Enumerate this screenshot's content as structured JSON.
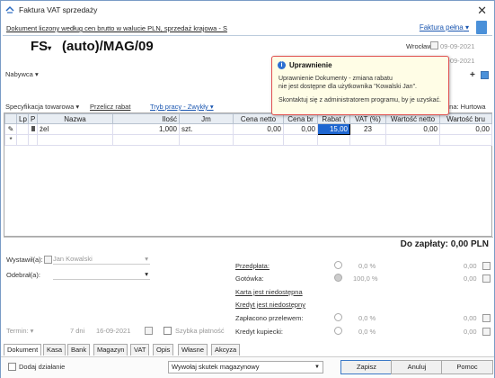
{
  "window": {
    "title": "Faktura VAT sprzedaży",
    "close": "✕"
  },
  "info": {
    "doc_desc": "Dokument liczony według cen brutto w walucie PLN, sprzedaż krajowa - S",
    "faktura": "Faktura pełna"
  },
  "header": {
    "series": "FS",
    "number": "(auto)/MAG/09",
    "location": "Wrocław",
    "date1": "09-09-2021",
    "date2": "09-09-2021",
    "nabywca_label": "Nabywca"
  },
  "toolbar": {
    "spec": "Specyfikacja towarowa",
    "przelicz": "Przelicz rabat",
    "tryb": "Tryb pracy - Zwykły",
    "cena": "ena: Hurtowa"
  },
  "columns": [
    "Lp",
    "P",
    "Nazwa",
    "Ilość",
    "Jm",
    "Cena netto",
    "Cena br",
    "Rabat (",
    "VAT (%)",
    "Wartość netto",
    "Wartość bru"
  ],
  "rows": [
    {
      "lp": "",
      "p": "",
      "nazwa": "żel",
      "ilosc": "1,000",
      "jm": "szt.",
      "cena_netto": "0,00",
      "cena_br": "0,00",
      "rabat": "15,00",
      "vat": "23",
      "wart_netto": "0,00",
      "wart_brutto": "0,00"
    }
  ],
  "popup": {
    "title": "Uprawnienie",
    "line1": "Uprawnienie Dokumenty - zmiana rabatu",
    "line2": "nie jest dostępne dla użytkownika \"Kowalski Jan\".",
    "line3": "Skontaktuj się z administratorem programu, by je uzyskać."
  },
  "total": "Do zapłaty: 0,00 PLN",
  "left": {
    "wystawil_label": "Wystawił(a):",
    "wystawil_value": "Jan Kowalski",
    "odebral_label": "Odebrał(a):",
    "termin_label": "Termin:",
    "termin_days": "7 dni",
    "termin_date": "16-09-2021",
    "szybka": "Szybka płatność"
  },
  "right": {
    "przedplata": "Przedpłata:",
    "gotowka": "Gotówka:",
    "karta": "Karta jest niedostępna",
    "kredyt": "Kredyt jest niedostępny",
    "zaplacono": "Zapłacono przelewem:",
    "kredyt_kup": "Kredyt kupiecki:",
    "pct0": "0,0 %",
    "pct100": "100,0 %",
    "zero": "0,00"
  },
  "tabs": [
    "Dokument",
    "Kasa",
    "Bank",
    "Magazyn",
    "VAT",
    "Opis",
    "Własne",
    "Akcyza"
  ],
  "footer": {
    "dodaj": "Dodaj działanie",
    "skutek": "Wywołaj skutek magazynowy",
    "zapisz": "Zapisz",
    "anuluj": "Anuluj",
    "pomoc": "Pomoc"
  }
}
